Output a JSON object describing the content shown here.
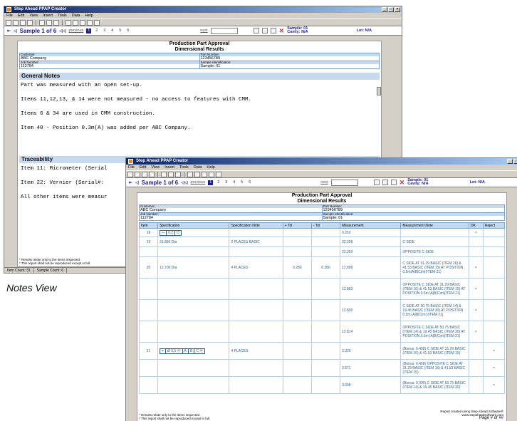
{
  "app": {
    "title": "Step Ahead PPAP Creator",
    "menu": [
      "File",
      "Edit",
      "View",
      "Insert",
      "Tools",
      "Data",
      "Help"
    ],
    "window_buttons": [
      "_",
      "□",
      "×"
    ]
  },
  "nav": {
    "sample_label": "Sample 1 of 6",
    "previous": "previous",
    "pages": [
      "1",
      "2",
      "3",
      "4",
      "5",
      "6"
    ],
    "next": "next",
    "sample_info": "Sample: 01",
    "cavity_info": "Cavity: N/A",
    "lot_info": "Lot: N/A"
  },
  "report": {
    "title_line1": "Production Part Approval",
    "title_line2": "Dimensional Results",
    "customer_label": "Customer:",
    "customer": "ABC Company",
    "part_label": "Part Number:",
    "part_number": "123456789",
    "job_label": "Job Number:",
    "job_number": "112784",
    "sample_id_label": "Sample Identification:",
    "sample_id": "Sample: 01",
    "footnote1": "* Results relate only to the items inspected.",
    "footnote2": "* This report shall not be reproduced except in full.",
    "report_credit": "Report created using Step Ahead Software®",
    "report_site": "www.stepaheadsoftware.com",
    "page_of": "Page # of ##"
  },
  "notes_view": {
    "general_heading": "General Notes",
    "general_notes": [
      "Part was measured with an open set-up.",
      "Items 11,12,13, & 14 were not measured - no access to features with CMM.",
      "Items 6 & 34 are used in CMM construction.",
      "Item 40 - Position 0.3m(A) was added per ABC Company."
    ],
    "traceability_heading": "Traceability",
    "traceability_notes": [
      "Item 11: Micrometer (Serial",
      "Item 22: Vernier (Serial#:",
      "All other items were measur"
    ],
    "status_item_count": "Item Count: 31",
    "status_sample_count": "Sample Count: 6",
    "caption": "Notes View"
  },
  "results_table": {
    "headers": [
      "Item",
      "Specification",
      "Specification Note",
      "+ Tol",
      "- Tol",
      "Measurement",
      "Measurement Note",
      "OK",
      "Reject"
    ],
    "rows": [
      {
        "item": "18",
        "spec": "",
        "spec_fcf": [
          "⏤",
          "0.2",
          "D"
        ],
        "spec_note": "",
        "ptol": "",
        "ntol": "",
        "meas": "0.263",
        "mnote": "",
        "ok": "×",
        "rej": ""
      },
      {
        "item": "19",
        "spec": "21.880 Dia",
        "spec_fcf": [],
        "spec_note": "2 PLACES BASIC",
        "ptol": "",
        "ntol": "",
        "meas": "22.295",
        "mnote": "C SIDE",
        "ok": "",
        "rej": ""
      },
      {
        "item": "",
        "spec": "",
        "spec_fcf": [],
        "spec_note": "",
        "ptol": "",
        "ntol": "",
        "meas": "22.350",
        "mnote": "OPPOSITE C SIDE",
        "ok": "",
        "rej": ""
      },
      {
        "item": "20",
        "spec": "12.700 Dia",
        "spec_fcf": [],
        "spec_note": "4 PLACES",
        "ptol": "0.280",
        "ntol": "0.280",
        "meas": "12.898",
        "mnote": "C SIDE AT 31.29 BASIC (ITEM 16) & 41.53 BASIC (ITEM 15) AT POSITION 0.5m|A|B|C|m|(ITEM 21)",
        "ok": "×",
        "rej": ""
      },
      {
        "item": "",
        "spec": "",
        "spec_fcf": [],
        "spec_note": "",
        "ptol": "",
        "ntol": "",
        "meas": "12.883",
        "mnote": "OPPOSITE C SIDE AT 31.29 BASIC (ITEM 16) & 41.53 BASIC (ITEM 15) AT POSITION 0.5m |A|B|C|m|(ITEM 21)",
        "ok": "×",
        "rej": ""
      },
      {
        "item": "",
        "spec": "",
        "spec_fcf": [],
        "spec_note": "",
        "ptol": "",
        "ntol": "",
        "meas": "12.830",
        "mnote": "C SIDE AT 50.75 BASIC (ITEM 14) & 19.45 BASIC (ITEM 30) AT POSITION 0.5m |A|B|C|m| (ITEM 21)",
        "ok": "×",
        "rej": ""
      },
      {
        "item": "",
        "spec": "",
        "spec_fcf": [],
        "spec_note": "",
        "ptol": "",
        "ntol": "",
        "meas": "12.814",
        "mnote": "OPPOSITE C SIDE AT 50.75 BASIC (ITEM 14) & 19.45 BASIC (ITEM 30) AT POSITION 0.5m |A|B|C|m|(ITEM 21)",
        "ok": "×",
        "rej": ""
      },
      {
        "item": "21",
        "spec": "",
        "spec_fcf": [
          "⌖",
          "Ø 0.5 Ⓜ",
          "A",
          "B",
          "C Ⓜ"
        ],
        "spec_note": "4 PLACES",
        "ptol": "",
        "ntol": "",
        "meas": "2.325",
        "mnote": "(Bonus: 0.458) C SIDE AT 31.29 BASIC (ITEM 16) & 41.53 BASIC (ITEM 15)",
        "ok": "",
        "rej": "×"
      },
      {
        "item": "",
        "spec": "",
        "spec_fcf": [],
        "spec_note": "",
        "ptol": "",
        "ntol": "",
        "meas": "2.571",
        "mnote": "(Bonus: 0.458) OPPOSITE C SIDE AT 31.29 BASIC (ITEM 16) & 41.53 BASIC (ITEM 15)",
        "ok": "",
        "rej": "×"
      },
      {
        "item": "",
        "spec": "",
        "spec_fcf": [],
        "spec_note": "",
        "ptol": "",
        "ntol": "",
        "meas": "3.698",
        "mnote": "(Bonus: 0.390) C SIDE AT 50.75 BASIC (ITEM 14) & 19.45 BASIC (ITEM 30)",
        "ok": "",
        "rej": "×"
      }
    ]
  },
  "colors": {
    "titlebar_start": "#0a246a",
    "titlebar_end": "#a6caf0",
    "header_fill": "#c7d9ee",
    "nav_text": "#1c1c8c",
    "reject_mark": "#cc3333"
  }
}
